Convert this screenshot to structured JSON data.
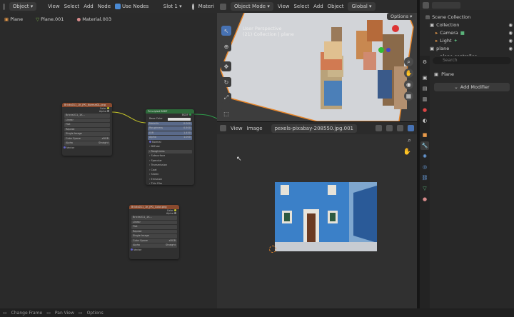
{
  "node_editor": {
    "header": {
      "mode": "Object",
      "menus": [
        "View",
        "Select",
        "Add",
        "Node"
      ],
      "use_nodes_label": "Use Nodes",
      "slot": "Slot 1",
      "material_short": "Materi"
    },
    "breadcrumb": [
      "Plane",
      "Plane.001",
      "Material.003"
    ],
    "nodes": {
      "image_node_1": {
        "title": "Bricks011_1K_JPG_NormalGL.png",
        "outputs": [
          "Color",
          "Alpha"
        ],
        "image_name": "Bricks011_1K...",
        "rows": [
          "Linear",
          "Flat",
          "Repeat",
          "Single Image",
          "Color Space",
          "Alpha"
        ],
        "values": [
          "",
          "",
          "",
          "",
          "sRGB",
          "Straight"
        ],
        "footer": "Vector"
      },
      "principled": {
        "title": "Principled BSDF",
        "output": "BSDF",
        "rows": [
          "Base Color",
          "Metallic",
          "Roughness",
          "IOR",
          "Alpha",
          "Normal"
        ],
        "values": [
          "",
          "0.000",
          "0.500",
          "1.450",
          "1.000",
          ""
        ],
        "subsections": [
          "Diffuse",
          "Roughness",
          "Subsurface",
          "Specular",
          "Transmission",
          "Coat",
          "Sheen",
          "Emission",
          "Thin Film"
        ]
      },
      "image_node_2": {
        "title": "Bricks011_1K_JPG_Color.png",
        "outputs": [
          "Color",
          "Alpha"
        ],
        "image_name": "Bricks011_1K...",
        "rows": [
          "Linear",
          "Flat",
          "Repeat",
          "Single Image",
          "Color Space",
          "Alpha"
        ],
        "values": [
          "",
          "",
          "",
          "",
          "sRGB",
          "Straight"
        ],
        "footer": "Vector"
      }
    }
  },
  "viewport": {
    "header": {
      "mode": "Object Mode",
      "menus": [
        "View",
        "Select",
        "Add",
        "Object"
      ],
      "orientation": "Global"
    },
    "overlay_title": "User Perspective",
    "overlay_subtitle": "(21) Collection | plane",
    "options_label": "Options"
  },
  "image_editor": {
    "header": {
      "menus": [
        "View",
        "Image"
      ],
      "image_name": "pexels-pixabay-208550.jpg.001"
    }
  },
  "outliner": {
    "items": [
      {
        "label": "Scene Collection",
        "indent": 0
      },
      {
        "label": "Collection",
        "indent": 1
      },
      {
        "label": "Camera",
        "indent": 2
      },
      {
        "label": "Light",
        "indent": 2
      },
      {
        "label": "plane",
        "indent": 1
      },
      {
        "label": "plane.controller",
        "indent": 2
      }
    ]
  },
  "properties": {
    "search_placeholder": "Search",
    "object_name": "Plane",
    "add_modifier_label": "Add Modifier"
  },
  "statusbar": {
    "items": [
      "Change Frame",
      "Pan View",
      "Options"
    ]
  },
  "colors": {
    "accent": "#4772b3",
    "image_node_header": "#8a4a2e",
    "shader_node_header": "#2d6a3a",
    "orange_selection": "#e8862a"
  }
}
